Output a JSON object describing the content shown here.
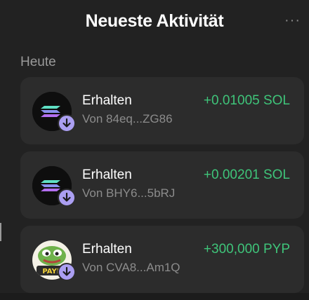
{
  "header": {
    "title": "Neueste Aktivität",
    "more_icon": "more-horizontal-icon"
  },
  "section": {
    "label": "Heute"
  },
  "activities": [
    {
      "type": "Erhalten",
      "from": "Von 84eq...ZG86",
      "amount": "+0.01005 SOL",
      "token_icon": "solana-icon",
      "badge_icon": "receive-arrow-icon"
    },
    {
      "type": "Erhalten",
      "from": "Von BHY6...5bRJ",
      "amount": "+0.00201 SOL",
      "token_icon": "solana-icon",
      "badge_icon": "receive-arrow-icon"
    },
    {
      "type": "Erhalten",
      "from": "Von CVA8...Am1Q",
      "amount": "+300,000 PYP",
      "token_icon": "pyp-token-icon",
      "badge_icon": "receive-arrow-icon"
    }
  ],
  "colors": {
    "background": "#222222",
    "card": "#2c2c2c",
    "positive": "#3fc57a",
    "badge": "#ab9ff2",
    "muted": "#8c8c8c"
  }
}
